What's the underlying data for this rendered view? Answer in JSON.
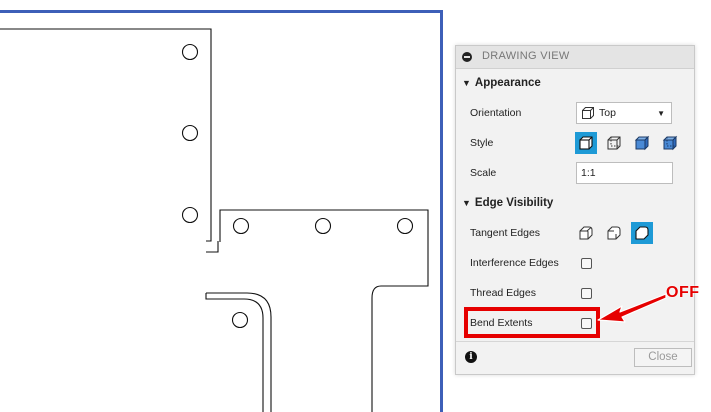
{
  "panel": {
    "title": "DRAWING VIEW",
    "appearance": {
      "heading": "Appearance",
      "orientation_label": "Orientation",
      "orientation_value": "Top",
      "style_label": "Style",
      "style_options": [
        "visible-edges-icon",
        "visible-and-hidden-edges-icon",
        "shaded-icon",
        "shaded-hidden-edges-icon"
      ],
      "style_selected_index": 0,
      "scale_label": "Scale",
      "scale_value": "1:1"
    },
    "edge_visibility": {
      "heading": "Edge Visibility",
      "tangent_label": "Tangent Edges",
      "tangent_options": [
        "full-length-tangent-icon",
        "short-tangent-icon",
        "no-tangent-icon"
      ],
      "tangent_selected_index": 2,
      "interference_label": "Interference Edges",
      "interference_checked": false,
      "thread_label": "Thread Edges",
      "thread_checked": false,
      "bend_label": "Bend Extents",
      "bend_checked": false
    },
    "close_label": "Close"
  },
  "annotation": {
    "off_text": "OFF",
    "color": "#e60000"
  },
  "colors": {
    "viewport_border": "#3d5fb8",
    "selected": "#1e9ad6"
  }
}
